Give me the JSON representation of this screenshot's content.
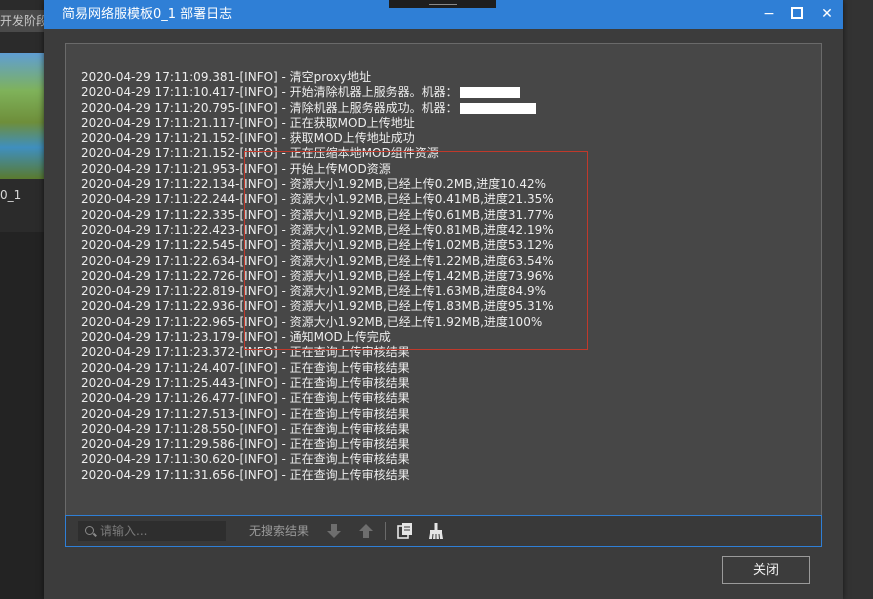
{
  "background_app": {
    "tab_label": "开发阶段",
    "thumb_label": "0_1"
  },
  "dialog": {
    "title": "简易网络服模板0_1 部署日志",
    "controls": {
      "minimize": "−",
      "close": "✕"
    },
    "log_lines": [
      {
        "text": "2020-04-29 17:11:09.381-[INFO] - 清空proxy地址"
      },
      {
        "text": "2020-04-29 17:11:10.417-[INFO] - 开始清除机器上服务器。机器：",
        "redacted": true
      },
      {
        "text": "2020-04-29 17:11:20.795-[INFO] - 清除机器上服务器成功。机器：",
        "redacted": true
      },
      {
        "text": "2020-04-29 17:11:21.117-[INFO] - 正在获取MOD上传地址"
      },
      {
        "text": "2020-04-29 17:11:21.152-[INFO] - 获取MOD上传地址成功"
      },
      {
        "text": "2020-04-29 17:11:21.152-[INFO] - 正在压缩本地MOD组件资源"
      },
      {
        "text": "2020-04-29 17:11:21.953-[INFO] - 开始上传MOD资源"
      },
      {
        "text": "2020-04-29 17:11:22.134-[INFO] - 资源大小1.92MB,已经上传0.2MB,进度10.42%"
      },
      {
        "text": "2020-04-29 17:11:22.244-[INFO] - 资源大小1.92MB,已经上传0.41MB,进度21.35%"
      },
      {
        "text": "2020-04-29 17:11:22.335-[INFO] - 资源大小1.92MB,已经上传0.61MB,进度31.77%"
      },
      {
        "text": "2020-04-29 17:11:22.423-[INFO] - 资源大小1.92MB,已经上传0.81MB,进度42.19%"
      },
      {
        "text": "2020-04-29 17:11:22.545-[INFO] - 资源大小1.92MB,已经上传1.02MB,进度53.12%"
      },
      {
        "text": "2020-04-29 17:11:22.634-[INFO] - 资源大小1.92MB,已经上传1.22MB,进度63.54%"
      },
      {
        "text": "2020-04-29 17:11:22.726-[INFO] - 资源大小1.92MB,已经上传1.42MB,进度73.96%"
      },
      {
        "text": "2020-04-29 17:11:22.819-[INFO] - 资源大小1.92MB,已经上传1.63MB,进度84.9%"
      },
      {
        "text": "2020-04-29 17:11:22.936-[INFO] - 资源大小1.92MB,已经上传1.83MB,进度95.31%"
      },
      {
        "text": "2020-04-29 17:11:22.965-[INFO] - 资源大小1.92MB,已经上传1.92MB,进度100%"
      },
      {
        "text": "2020-04-29 17:11:23.179-[INFO] - 通知MOD上传完成"
      },
      {
        "text": "2020-04-29 17:11:23.372-[INFO] - 正在查询上传审核结果"
      },
      {
        "text": "2020-04-29 17:11:24.407-[INFO] - 正在查询上传审核结果"
      },
      {
        "text": "2020-04-29 17:11:25.443-[INFO] - 正在查询上传审核结果"
      },
      {
        "text": "2020-04-29 17:11:26.477-[INFO] - 正在查询上传审核结果"
      },
      {
        "text": "2020-04-29 17:11:27.513-[INFO] - 正在查询上传审核结果"
      },
      {
        "text": "2020-04-29 17:11:28.550-[INFO] - 正在查询上传审核结果"
      },
      {
        "text": "2020-04-29 17:11:29.586-[INFO] - 正在查询上传审核结果"
      },
      {
        "text": "2020-04-29 17:11:30.620-[INFO] - 正在查询上传审核结果"
      },
      {
        "text": "2020-04-29 17:11:31.656-[INFO] - 正在查询上传审核结果"
      }
    ],
    "toolbar": {
      "search_placeholder": "请输入...",
      "no_result_text": "无搜索结果"
    },
    "close_button_label": "关闭"
  },
  "colors": {
    "titlebar": "#2f7fd6",
    "highlight_box": "#c0392b"
  },
  "icons": {
    "search": "search-icon",
    "next": "arrow-down-icon",
    "prev": "arrow-up-icon",
    "copy": "copy-icon",
    "clear": "broom-icon"
  }
}
